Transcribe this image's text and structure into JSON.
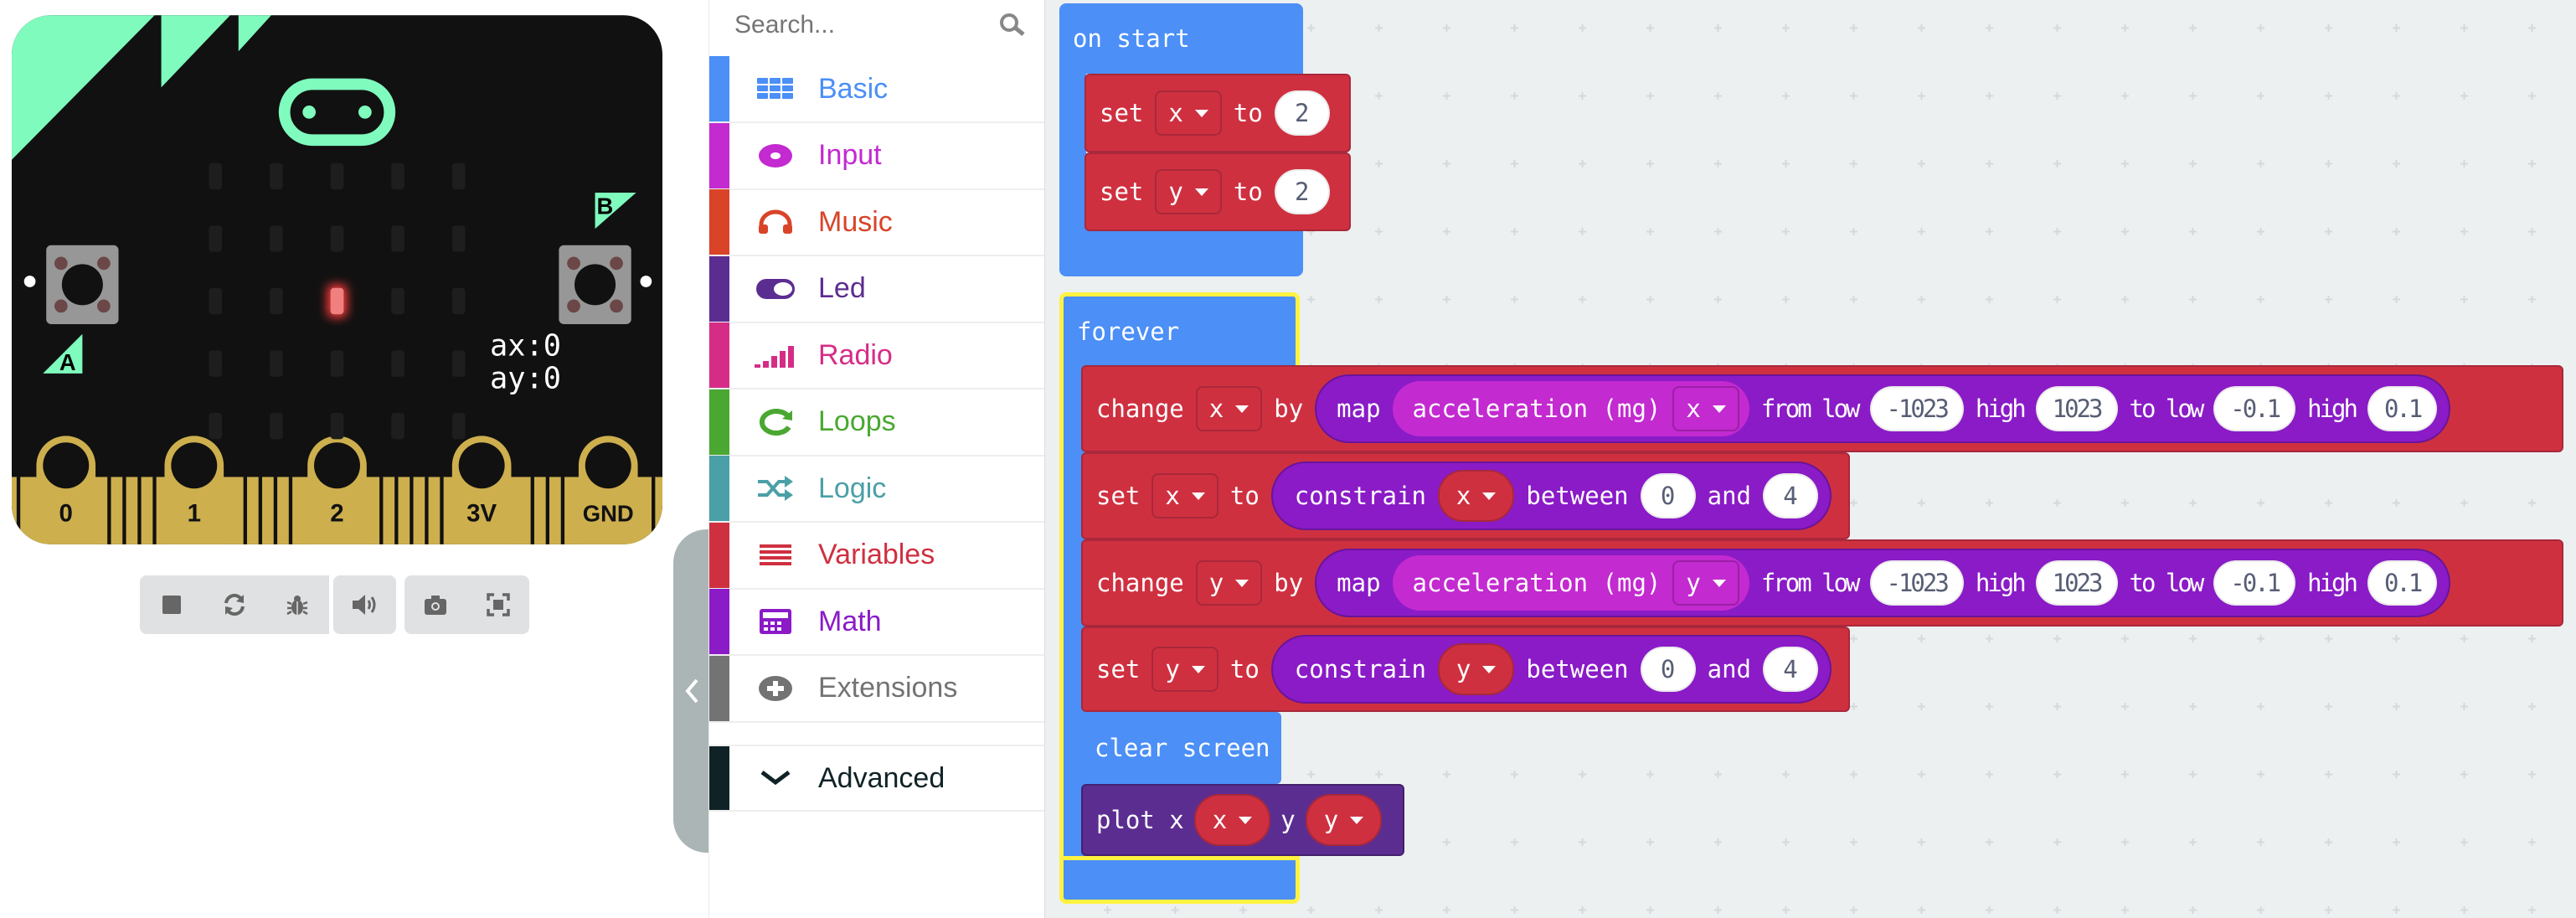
{
  "simulator": {
    "button_a": "A",
    "button_b": "B",
    "readout_ax": "ax:0",
    "readout_ay": "ay:0",
    "pins": [
      "0",
      "1",
      "2",
      "3V",
      "GND"
    ],
    "lit_led": {
      "row": 2,
      "col": 2
    },
    "colors": {
      "board": "#111111",
      "accent": "#7ffbbd",
      "gold": "#cdaf4e",
      "led_on": "#f08080"
    },
    "toolbar": [
      "stop-icon",
      "restart-icon",
      "debug-icon",
      "mute-icon",
      "screenshot-icon",
      "fullscreen-icon"
    ]
  },
  "toolbox": {
    "search_placeholder": "Search...",
    "categories": [
      {
        "label": "Basic",
        "color": "#4b8ff7",
        "icon": "grid-icon"
      },
      {
        "label": "Input",
        "color": "#c32ad0",
        "icon": "target-icon"
      },
      {
        "label": "Music",
        "color": "#d94429",
        "icon": "headphones-icon"
      },
      {
        "label": "Led",
        "color": "#5c2d91",
        "icon": "toggle-icon"
      },
      {
        "label": "Radio",
        "color": "#d52d86",
        "icon": "signal-icon"
      },
      {
        "label": "Loops",
        "color": "#4aa832",
        "icon": "loop-icon"
      },
      {
        "label": "Logic",
        "color": "#4aa0a6",
        "icon": "shuffle-icon"
      },
      {
        "label": "Variables",
        "color": "#cf3040",
        "icon": "list-icon"
      },
      {
        "label": "Math",
        "color": "#8a1bc7",
        "icon": "calculator-icon"
      },
      {
        "label": "Extensions",
        "color": "#737373",
        "icon": "plus-circle-icon"
      }
    ],
    "advanced": {
      "label": "Advanced",
      "color": "#0f2327",
      "icon": "chevron-down-icon"
    }
  },
  "blocks": {
    "on_start": {
      "label": "on start",
      "set_x": {
        "kw": "set",
        "var": "x",
        "to": "to",
        "value": "2"
      },
      "set_y": {
        "kw": "set",
        "var": "y",
        "to": "to",
        "value": "2"
      }
    },
    "forever": {
      "label": "forever",
      "change_x": {
        "kw": "change",
        "var": "x",
        "by": "by",
        "map": "map",
        "accel": "acceleration (mg)",
        "axis": "x",
        "from_low": "from low",
        "from_low_val": "-1023",
        "high": "high",
        "from_high_val": "1023",
        "to_low": "to low",
        "to_low_val": "-0.1",
        "high2": "high",
        "to_high_val": "0.1"
      },
      "set_x": {
        "kw": "set",
        "var": "x",
        "to": "to",
        "constrain": "constrain",
        "cvar": "x",
        "between": "between",
        "low": "0",
        "and": "and",
        "high": "4"
      },
      "change_y": {
        "kw": "change",
        "var": "y",
        "by": "by",
        "map": "map",
        "accel": "acceleration (mg)",
        "axis": "y",
        "from_low": "from low",
        "from_low_val": "-1023",
        "high": "high",
        "from_high_val": "1023",
        "to_low": "to low",
        "to_low_val": "-0.1",
        "high2": "high",
        "to_high_val": "0.1"
      },
      "set_y": {
        "kw": "set",
        "var": "y",
        "to": "to",
        "constrain": "constrain",
        "cvar": "y",
        "between": "between",
        "low": "0",
        "and": "and",
        "high": "4"
      },
      "clear_screen": "clear screen",
      "plot": {
        "kw": "plot x",
        "xvar": "x",
        "ykw": "y",
        "yvar": "y"
      }
    }
  }
}
